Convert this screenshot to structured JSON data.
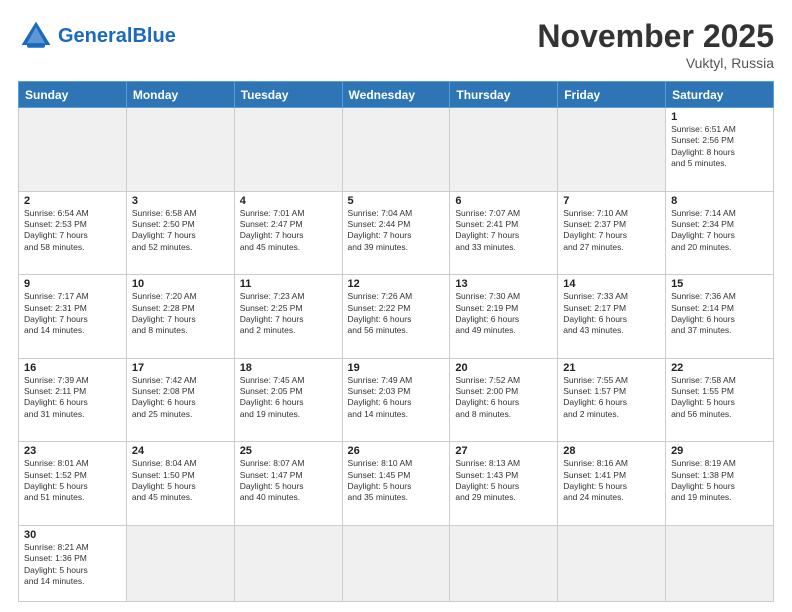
{
  "header": {
    "logo_general": "General",
    "logo_blue": "Blue",
    "month_title": "November 2025",
    "location": "Vuktyl, Russia"
  },
  "days_of_week": [
    "Sunday",
    "Monday",
    "Tuesday",
    "Wednesday",
    "Thursday",
    "Friday",
    "Saturday"
  ],
  "weeks": [
    {
      "days": [
        {
          "num": "",
          "empty": true
        },
        {
          "num": "",
          "empty": true
        },
        {
          "num": "",
          "empty": true
        },
        {
          "num": "",
          "empty": true
        },
        {
          "num": "",
          "empty": true
        },
        {
          "num": "",
          "empty": true
        },
        {
          "num": "1",
          "info": "Sunrise: 6:51 AM\nSunset: 2:56 PM\nDaylight: 8 hours\nand 5 minutes."
        }
      ]
    },
    {
      "days": [
        {
          "num": "2",
          "info": "Sunrise: 6:54 AM\nSunset: 2:53 PM\nDaylight: 7 hours\nand 58 minutes."
        },
        {
          "num": "3",
          "info": "Sunrise: 6:58 AM\nSunset: 2:50 PM\nDaylight: 7 hours\nand 52 minutes."
        },
        {
          "num": "4",
          "info": "Sunrise: 7:01 AM\nSunset: 2:47 PM\nDaylight: 7 hours\nand 45 minutes."
        },
        {
          "num": "5",
          "info": "Sunrise: 7:04 AM\nSunset: 2:44 PM\nDaylight: 7 hours\nand 39 minutes."
        },
        {
          "num": "6",
          "info": "Sunrise: 7:07 AM\nSunset: 2:41 PM\nDaylight: 7 hours\nand 33 minutes."
        },
        {
          "num": "7",
          "info": "Sunrise: 7:10 AM\nSunset: 2:37 PM\nDaylight: 7 hours\nand 27 minutes."
        },
        {
          "num": "8",
          "info": "Sunrise: 7:14 AM\nSunset: 2:34 PM\nDaylight: 7 hours\nand 20 minutes."
        }
      ]
    },
    {
      "days": [
        {
          "num": "9",
          "info": "Sunrise: 7:17 AM\nSunset: 2:31 PM\nDaylight: 7 hours\nand 14 minutes."
        },
        {
          "num": "10",
          "info": "Sunrise: 7:20 AM\nSunset: 2:28 PM\nDaylight: 7 hours\nand 8 minutes."
        },
        {
          "num": "11",
          "info": "Sunrise: 7:23 AM\nSunset: 2:25 PM\nDaylight: 7 hours\nand 2 minutes."
        },
        {
          "num": "12",
          "info": "Sunrise: 7:26 AM\nSunset: 2:22 PM\nDaylight: 6 hours\nand 56 minutes."
        },
        {
          "num": "13",
          "info": "Sunrise: 7:30 AM\nSunset: 2:19 PM\nDaylight: 6 hours\nand 49 minutes."
        },
        {
          "num": "14",
          "info": "Sunrise: 7:33 AM\nSunset: 2:17 PM\nDaylight: 6 hours\nand 43 minutes."
        },
        {
          "num": "15",
          "info": "Sunrise: 7:36 AM\nSunset: 2:14 PM\nDaylight: 6 hours\nand 37 minutes."
        }
      ]
    },
    {
      "days": [
        {
          "num": "16",
          "info": "Sunrise: 7:39 AM\nSunset: 2:11 PM\nDaylight: 6 hours\nand 31 minutes."
        },
        {
          "num": "17",
          "info": "Sunrise: 7:42 AM\nSunset: 2:08 PM\nDaylight: 6 hours\nand 25 minutes."
        },
        {
          "num": "18",
          "info": "Sunrise: 7:45 AM\nSunset: 2:05 PM\nDaylight: 6 hours\nand 19 minutes."
        },
        {
          "num": "19",
          "info": "Sunrise: 7:49 AM\nSunset: 2:03 PM\nDaylight: 6 hours\nand 14 minutes."
        },
        {
          "num": "20",
          "info": "Sunrise: 7:52 AM\nSunset: 2:00 PM\nDaylight: 6 hours\nand 8 minutes."
        },
        {
          "num": "21",
          "info": "Sunrise: 7:55 AM\nSunset: 1:57 PM\nDaylight: 6 hours\nand 2 minutes."
        },
        {
          "num": "22",
          "info": "Sunrise: 7:58 AM\nSunset: 1:55 PM\nDaylight: 5 hours\nand 56 minutes."
        }
      ]
    },
    {
      "days": [
        {
          "num": "23",
          "info": "Sunrise: 8:01 AM\nSunset: 1:52 PM\nDaylight: 5 hours\nand 51 minutes."
        },
        {
          "num": "24",
          "info": "Sunrise: 8:04 AM\nSunset: 1:50 PM\nDaylight: 5 hours\nand 45 minutes."
        },
        {
          "num": "25",
          "info": "Sunrise: 8:07 AM\nSunset: 1:47 PM\nDaylight: 5 hours\nand 40 minutes."
        },
        {
          "num": "26",
          "info": "Sunrise: 8:10 AM\nSunset: 1:45 PM\nDaylight: 5 hours\nand 35 minutes."
        },
        {
          "num": "27",
          "info": "Sunrise: 8:13 AM\nSunset: 1:43 PM\nDaylight: 5 hours\nand 29 minutes."
        },
        {
          "num": "28",
          "info": "Sunrise: 8:16 AM\nSunset: 1:41 PM\nDaylight: 5 hours\nand 24 minutes."
        },
        {
          "num": "29",
          "info": "Sunrise: 8:19 AM\nSunset: 1:38 PM\nDaylight: 5 hours\nand 19 minutes."
        }
      ]
    },
    {
      "days": [
        {
          "num": "30",
          "info": "Sunrise: 8:21 AM\nSunset: 1:36 PM\nDaylight: 5 hours\nand 14 minutes."
        },
        {
          "num": "",
          "empty": true
        },
        {
          "num": "",
          "empty": true
        },
        {
          "num": "",
          "empty": true
        },
        {
          "num": "",
          "empty": true
        },
        {
          "num": "",
          "empty": true
        },
        {
          "num": "",
          "empty": true
        }
      ]
    }
  ]
}
